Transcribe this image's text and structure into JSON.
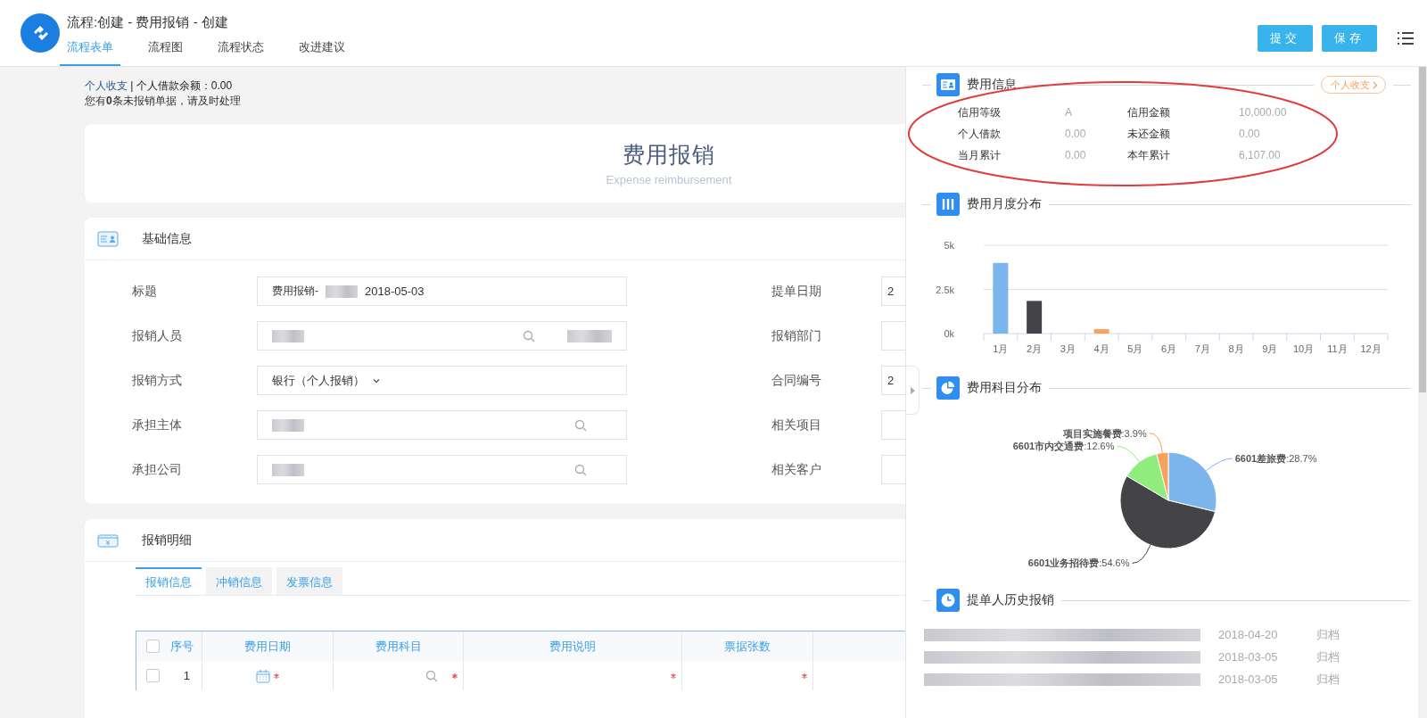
{
  "header": {
    "title": "流程:创建 - 费用报销 - 创建",
    "tabs": [
      {
        "label": "流程表单",
        "selected": true
      },
      {
        "label": "流程图",
        "selected": false
      },
      {
        "label": "流程状态",
        "selected": false
      },
      {
        "label": "改进建议",
        "selected": false
      }
    ],
    "buttons": [
      "提交",
      "保存"
    ]
  },
  "summary": {
    "link": "个人收支",
    "separator": "|",
    "balance": "个人借款余额：0.00",
    "notice": "您有**0**条未报销单据，请及时处理"
  },
  "form_title": {
    "title": "费用报销",
    "subtitle": "Expense reimbursement"
  },
  "basic_info": {
    "title": "基础信息",
    "rows": [
      {
        "left": {
          "label": "标题",
          "segments": [
            {
              "kind": "text",
              "text": "费用报销-"
            },
            {
              "kind": "blur"
            },
            {
              "kind": "text",
              "text": "2018-05-03"
            }
          ]
        },
        "right": {
          "label": "提单日期",
          "segments": [
            {
              "kind": "text",
              "text": "2"
            }
          ]
        }
      },
      {
        "left": {
          "label": "报销人员",
          "segments": [
            {
              "kind": "blur"
            },
            {
              "kind": "search"
            },
            {
              "kind": "blur"
            }
          ]
        },
        "right": {
          "label": "报销部门"
        }
      },
      {
        "left": {
          "label": "报销方式",
          "segments": [
            {
              "kind": "text",
              "text": "银行（个人报销）"
            },
            {
              "kind": "caret"
            }
          ]
        },
        "right": {
          "label": "合同编号",
          "segments": [
            {
              "kind": "text",
              "text": "2"
            }
          ]
        }
      },
      {
        "left": {
          "label": "承担主体",
          "segments": [
            {
              "kind": "blur"
            },
            {
              "kind": "search"
            }
          ]
        },
        "right": {
          "label": "相关项目"
        }
      },
      {
        "left": {
          "label": "承担公司",
          "segments": [
            {
              "kind": "blur"
            },
            {
              "kind": "search"
            }
          ]
        },
        "right": {
          "label": "相关客户"
        }
      }
    ]
  },
  "details": {
    "title": "报销明细",
    "tabs": [
      {
        "label": "报销信息",
        "selected": true
      },
      {
        "label": "冲销信息",
        "selected": false
      },
      {
        "label": "发票信息",
        "selected": false
      }
    ],
    "table": {
      "header_checked": false,
      "columns": [
        {
          "label": "序号",
          "kind": "index",
          "required": false
        },
        {
          "label": "费用日期",
          "kind": "date",
          "required": true
        },
        {
          "label": "费用科目",
          "kind": "lookup",
          "required": true
        },
        {
          "label": "费用说明",
          "kind": "text",
          "required": true
        },
        {
          "label": "票据张数",
          "kind": "text",
          "required": true
        }
      ],
      "rows": [
        {
          "checked": false,
          "index": "1"
        }
      ]
    }
  },
  "side_panel": {
    "fee_info": {
      "title": "费用信息",
      "link": "个人收支",
      "circled": true,
      "items": [
        {
          "label": "信用等级",
          "value": "A"
        },
        {
          "label": "信用金额",
          "value": "10,000.00"
        },
        {
          "label": "个人借款",
          "value": "0.00"
        },
        {
          "label": "未还金额",
          "value": "0.00"
        },
        {
          "label": "当月累计",
          "value": "0.00"
        },
        {
          "label": "本年累计",
          "value": "6,107.00"
        }
      ]
    },
    "monthly": {
      "title": "费用月度分布",
      "chart_data": {
        "type": "bar",
        "stacked": true,
        "categories": [
          "1月",
          "2月",
          "3月",
          "4月",
          "5月",
          "6月",
          "7月",
          "8月",
          "9月",
          "10月",
          "11月",
          "12月"
        ],
        "series": [
          {
            "color": "#7cb5ec",
            "values": [
              4000,
              null,
              null,
              null,
              null,
              null,
              null,
              null,
              null,
              null,
              null,
              null
            ]
          },
          {
            "color": "#434348",
            "values": [
              null,
              1850,
              null,
              null,
              null,
              null,
              null,
              null,
              null,
              null,
              null,
              null
            ]
          },
          {
            "color": "#f7a35c",
            "values": [
              null,
              null,
              null,
              250,
              null,
              null,
              null,
              null,
              null,
              null,
              null,
              null
            ]
          }
        ],
        "ylim": [
          0,
          5000
        ],
        "yticks": [
          {
            "value": 0,
            "label": "0k"
          },
          {
            "value": 2500,
            "label": "2.5k"
          },
          {
            "value": 5000,
            "label": "5k"
          }
        ]
      }
    },
    "subjects": {
      "title": "费用科目分布",
      "chart_data": {
        "type": "pie",
        "categories": [
          "6601差旅费",
          "6601业务招待费",
          "6601市内交通费",
          "项目实施餐费"
        ],
        "values": [
          28.7,
          54.6,
          12.6,
          3.9
        ],
        "colors": [
          "#7cb5ec",
          "#434348",
          "#90ed7d",
          "#f7a35c"
        ],
        "value_labels": [
          ":28.7%",
          ":54.6%",
          ":12.6%",
          ":3.9%"
        ]
      }
    },
    "history": {
      "title": "提单人历史报销",
      "rows": [
        {
          "date": "2018-04-20",
          "status": "归档"
        },
        {
          "date": "2018-03-05",
          "status": "归档"
        },
        {
          "date": "2018-03-05",
          "status": "归档"
        }
      ]
    }
  }
}
